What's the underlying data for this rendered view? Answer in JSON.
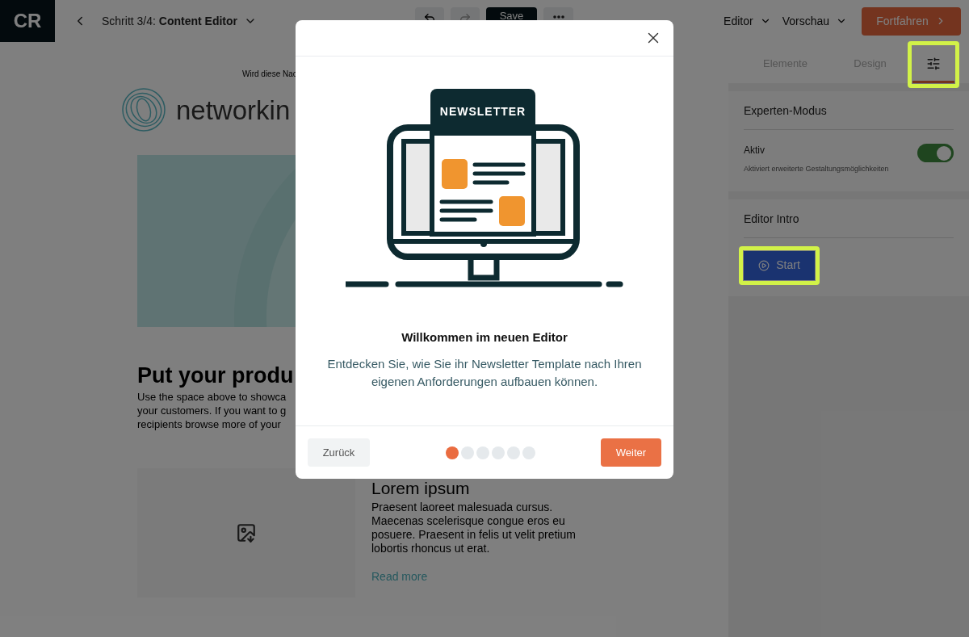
{
  "topbar": {
    "logo": "CR",
    "breadcrumb": "Schritt 3/4: **Content Editor**",
    "save": "Save",
    "menus": [
      {
        "label": "Editor"
      },
      {
        "label": "Vorschau"
      }
    ],
    "primary": "Fortfahren"
  },
  "canvas": {
    "preheader": "Wird diese Nac",
    "brand": "networkin",
    "heading": "Put your produ",
    "intro_lines": [
      "Use the space above to showca",
      "your customers. If you want to g",
      "recipients browse more of your"
    ],
    "article": {
      "title": "Lorem ipsum",
      "lines": [
        "Praesent laoreet malesuada cursus.",
        "Maecenas scelerisque congue eros eu",
        "posuere. Praesent in felis ut velit pretium",
        "lobortis rhoncus ut erat."
      ],
      "link": "Read more"
    }
  },
  "sidebar": {
    "tabs": [
      {
        "kind": "text",
        "label": "Elemente",
        "selected": false,
        "highlighted": false
      },
      {
        "kind": "text",
        "label": "Design",
        "selected": false,
        "highlighted": false
      },
      {
        "kind": "icon",
        "selected": true,
        "highlighted": true
      }
    ],
    "sections": [
      {
        "kind": "toggle",
        "title": "Experten-Modus",
        "label": "Aktiv",
        "hint": "Aktiviert erweiterte Gestaltungsmöglichkeiten",
        "on": true
      },
      {
        "kind": "button",
        "title": "Editor Intro",
        "button": "Start",
        "highlighted": true
      }
    ]
  },
  "dialog": {
    "illustration_label": "NEWSLETTER",
    "title": "Willkommen im neuen Editor",
    "text": "Entdecken Sie, wie Sie ihr Newsletter Template nach Ihren eigenen Anforderungen aufbauen können.",
    "back": "Zurück",
    "next": "Weiter",
    "steps": [
      {
        "selected": true
      },
      {
        "selected": false
      },
      {
        "selected": false
      },
      {
        "selected": false
      },
      {
        "selected": false
      },
      {
        "selected": false
      }
    ]
  }
}
